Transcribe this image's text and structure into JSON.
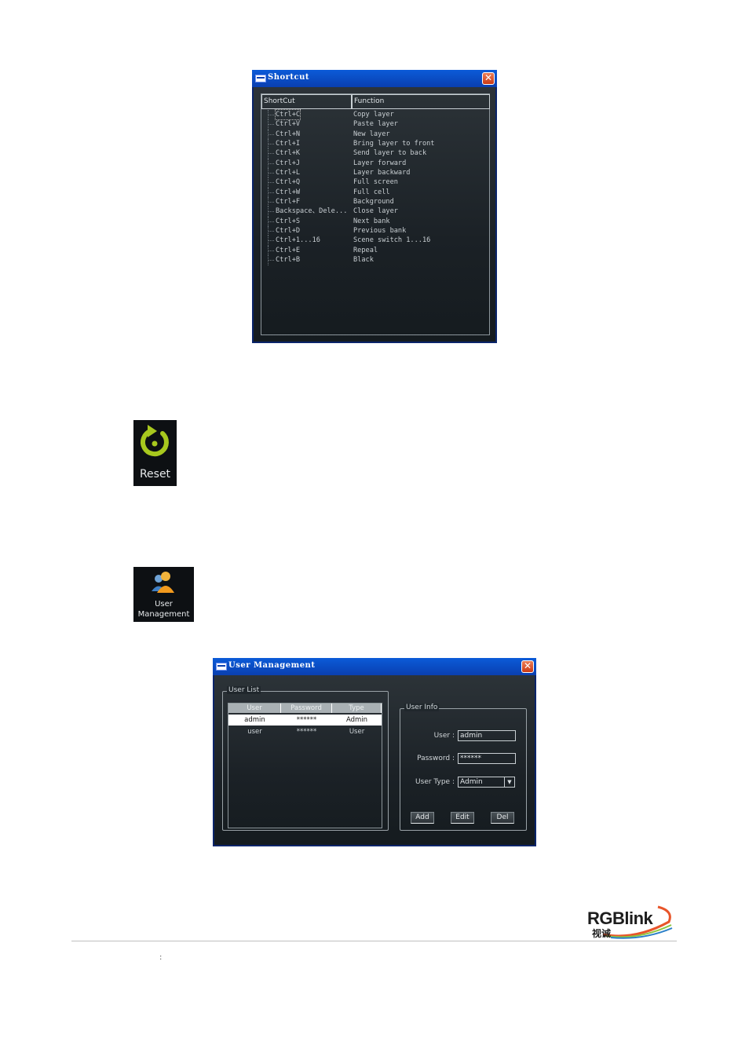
{
  "shortcut_window": {
    "title": "Shortcut",
    "close_glyph": "✕",
    "columns": [
      "ShortCut",
      "Function"
    ],
    "rows": [
      {
        "key": "Ctrl+C",
        "func": "Copy layer"
      },
      {
        "key": "Ctrl+V",
        "func": "Paste layer"
      },
      {
        "key": "Ctrl+N",
        "func": "New layer"
      },
      {
        "key": "Ctrl+I",
        "func": "Bring layer to front"
      },
      {
        "key": "Ctrl+K",
        "func": "Send layer to back"
      },
      {
        "key": "Ctrl+J",
        "func": "Layer forward"
      },
      {
        "key": "Ctrl+L",
        "func": "Layer backward"
      },
      {
        "key": "Ctrl+Q",
        "func": "Full screen"
      },
      {
        "key": "Ctrl+W",
        "func": "Full cell"
      },
      {
        "key": "Ctrl+F",
        "func": "Background"
      },
      {
        "key": "Backspace、Dele...",
        "func": "Close layer"
      },
      {
        "key": "Ctrl+S",
        "func": "Next bank"
      },
      {
        "key": "Ctrl+D",
        "func": "Previous bank"
      },
      {
        "key": "Ctrl+1...16",
        "func": "Scene switch 1...16"
      },
      {
        "key": "Ctrl+E",
        "func": "Repeal"
      },
      {
        "key": "Ctrl+B",
        "func": "Black"
      }
    ]
  },
  "reset_button": {
    "label": "Reset",
    "icon": "reset-icon",
    "color": "#a8c81e"
  },
  "user_mgmt_button": {
    "label_line1": "User",
    "label_line2": "Management",
    "icon": "users-icon"
  },
  "user_mgmt_window": {
    "title": "User Management",
    "close_glyph": "✕",
    "user_list": {
      "label": "User List",
      "columns": [
        "User",
        "Password",
        "Type"
      ],
      "rows": [
        {
          "user": "admin",
          "password": "******",
          "type": "Admin"
        },
        {
          "user": "user",
          "password": "******",
          "type": "User"
        }
      ]
    },
    "user_info": {
      "label": "User Info",
      "user_label": "User :",
      "user_value": "admin",
      "password_label": "Password :",
      "password_value": "******",
      "type_label": "User Type :",
      "type_value": "Admin",
      "add_label": "Add",
      "edit_label": "Edit",
      "del_label": "Del"
    }
  },
  "footer": {
    "logo_text": "RGBlink",
    "logo_sub": "视诚",
    "colon": ":"
  }
}
